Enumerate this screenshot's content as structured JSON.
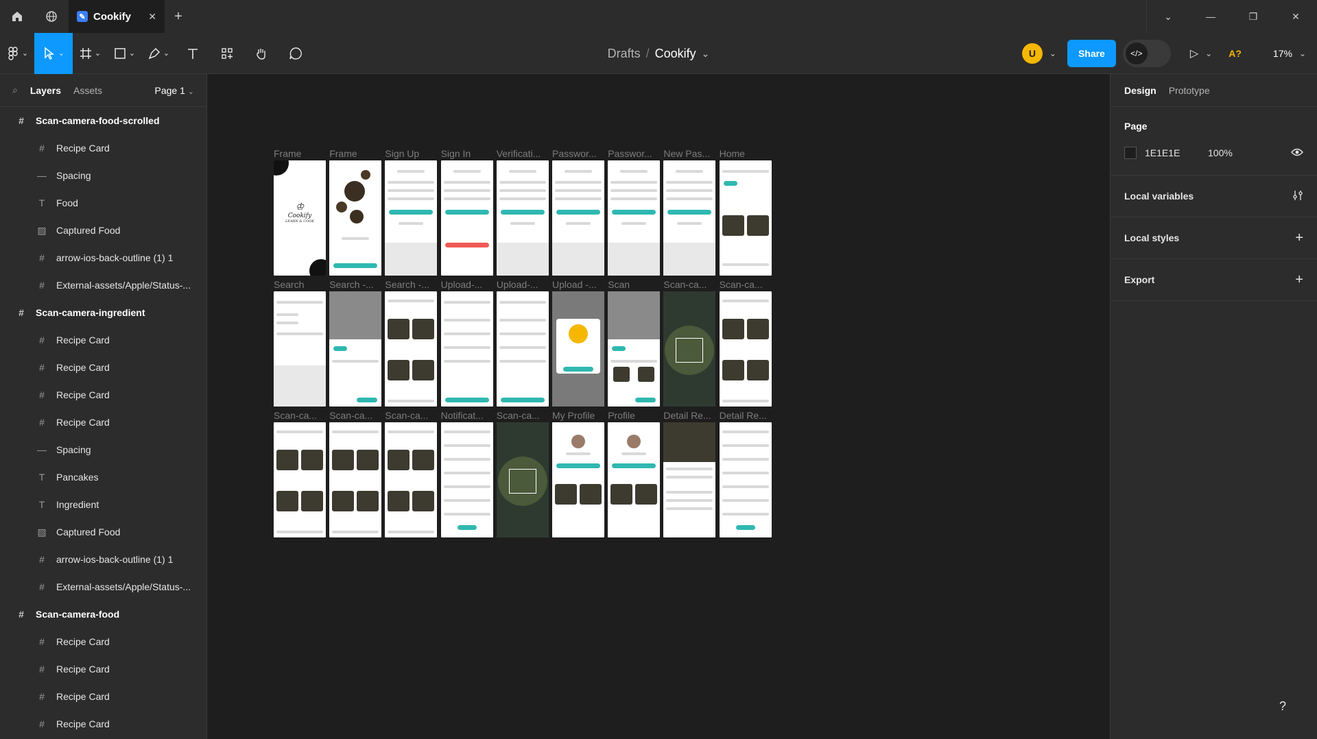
{
  "titlebar": {
    "tab_title": "Cookify",
    "window_controls": [
      "chevron-down",
      "minimize",
      "restore",
      "close"
    ]
  },
  "breadcrumb": {
    "drafts": "Drafts",
    "separator": "/",
    "file": "Cookify"
  },
  "toolbar_right": {
    "avatar": "U",
    "share": "Share",
    "ai": "A?",
    "zoom": "17%"
  },
  "left_panel": {
    "tab_layers": "Layers",
    "tab_assets": "Assets",
    "page_selector": "Page 1",
    "layers": [
      {
        "type": "frame",
        "icon": "frame-icon",
        "label": "Scan-camera-food-scrolled"
      },
      {
        "type": "child",
        "icon": "frame-icon",
        "label": "Recipe Card"
      },
      {
        "type": "child",
        "icon": "line-icon",
        "label": "Spacing"
      },
      {
        "type": "child",
        "icon": "text-icon",
        "label": "Food"
      },
      {
        "type": "child",
        "icon": "image-icon",
        "label": "Captured Food"
      },
      {
        "type": "child",
        "icon": "frame-icon",
        "label": "arrow-ios-back-outline (1) 1"
      },
      {
        "type": "child",
        "icon": "frame-icon",
        "label": "External-assets/Apple/Status-..."
      },
      {
        "type": "frame",
        "icon": "frame-icon",
        "label": "Scan-camera-ingredient"
      },
      {
        "type": "child",
        "icon": "frame-icon",
        "label": "Recipe Card"
      },
      {
        "type": "child",
        "icon": "frame-icon",
        "label": "Recipe Card"
      },
      {
        "type": "child",
        "icon": "frame-icon",
        "label": "Recipe Card"
      },
      {
        "type": "child",
        "icon": "frame-icon",
        "label": "Recipe Card"
      },
      {
        "type": "child",
        "icon": "line-icon",
        "label": "Spacing"
      },
      {
        "type": "child",
        "icon": "text-icon",
        "label": "Pancakes"
      },
      {
        "type": "child",
        "icon": "text-icon",
        "label": "Ingredient"
      },
      {
        "type": "child",
        "icon": "image-icon",
        "label": "Captured Food"
      },
      {
        "type": "child",
        "icon": "frame-icon",
        "label": "arrow-ios-back-outline (1) 1"
      },
      {
        "type": "child",
        "icon": "frame-icon",
        "label": "External-assets/Apple/Status-..."
      },
      {
        "type": "frame",
        "icon": "frame-icon",
        "label": "Scan-camera-food"
      },
      {
        "type": "child",
        "icon": "frame-icon",
        "label": "Recipe Card"
      },
      {
        "type": "child",
        "icon": "frame-icon",
        "label": "Recipe Card"
      },
      {
        "type": "child",
        "icon": "frame-icon",
        "label": "Recipe Card"
      },
      {
        "type": "child",
        "icon": "frame-icon",
        "label": "Recipe Card"
      }
    ]
  },
  "canvas": {
    "rows": [
      [
        {
          "label": "Frame",
          "kind": "splash"
        },
        {
          "label": "Frame",
          "kind": "onboard"
        },
        {
          "label": "Sign Up",
          "kind": "form"
        },
        {
          "label": "Sign In",
          "kind": "signin"
        },
        {
          "label": "Verificati...",
          "kind": "form"
        },
        {
          "label": "Passwor...",
          "kind": "form"
        },
        {
          "label": "Passwor...",
          "kind": "form"
        },
        {
          "label": "New Pas...",
          "kind": "form"
        },
        {
          "label": "Home",
          "kind": "home"
        }
      ],
      [
        {
          "label": "Search",
          "kind": "search"
        },
        {
          "label": "Search -...",
          "kind": "filter"
        },
        {
          "label": "Search -...",
          "kind": "grid"
        },
        {
          "label": "Upload-...",
          "kind": "upload"
        },
        {
          "label": "Upload-...",
          "kind": "upload"
        },
        {
          "label": "Upload -...",
          "kind": "success"
        },
        {
          "label": "Scan",
          "kind": "scan"
        },
        {
          "label": "Scan-ca...",
          "kind": "photo"
        },
        {
          "label": "Scan-ca...",
          "kind": "grid"
        }
      ],
      [
        {
          "label": "Scan-ca...",
          "kind": "grid"
        },
        {
          "label": "Scan-ca...",
          "kind": "grid"
        },
        {
          "label": "Scan-ca...",
          "kind": "grid"
        },
        {
          "label": "Notificat...",
          "kind": "list"
        },
        {
          "label": "Scan-ca...",
          "kind": "photo"
        },
        {
          "label": "My Profile",
          "kind": "profile"
        },
        {
          "label": "Profile",
          "kind": "profile"
        },
        {
          "label": "Detail Re...",
          "kind": "detail"
        },
        {
          "label": "Detail Re...",
          "kind": "list"
        }
      ]
    ],
    "splash_text": "Cookify",
    "splash_sub": "LEARN & COOK"
  },
  "right_panel": {
    "tab_design": "Design",
    "tab_prototype": "Prototype",
    "page_title": "Page",
    "page_color": "1E1E1E",
    "page_opacity": "100%",
    "sections": [
      "Local variables",
      "Local styles",
      "Export"
    ]
  },
  "help": "?"
}
